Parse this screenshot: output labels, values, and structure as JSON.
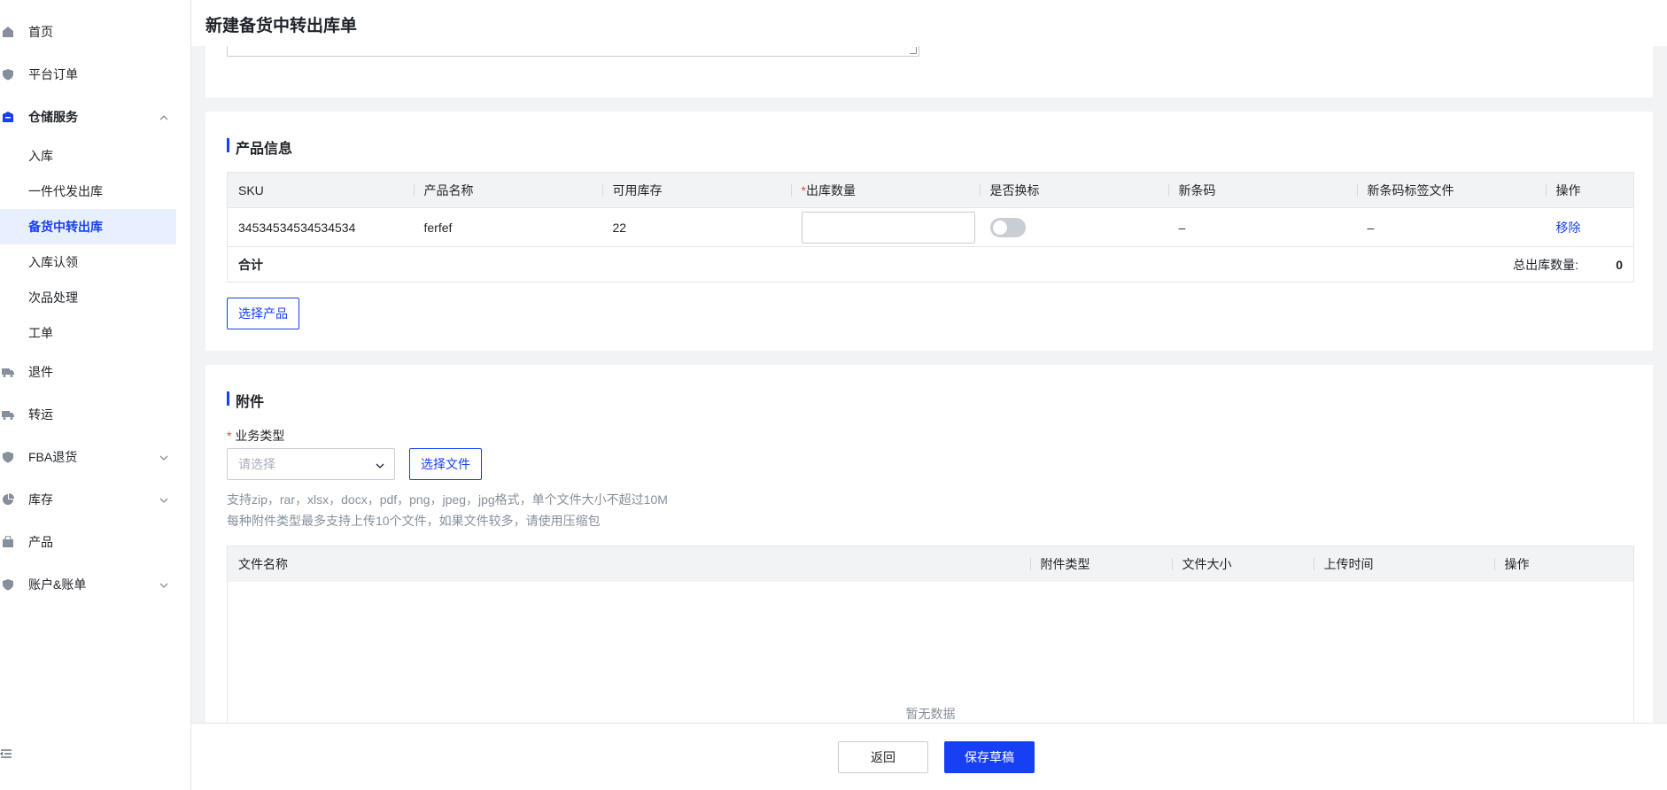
{
  "sidebar": {
    "items": [
      {
        "label": "首页",
        "icon": "home-icon"
      },
      {
        "label": "平台订单",
        "icon": "shield-icon"
      },
      {
        "label": "仓储服务",
        "icon": "warehouse-icon",
        "expanded": true
      },
      {
        "label": "退件",
        "icon": "truck-icon"
      },
      {
        "label": "转运",
        "icon": "truck-icon"
      },
      {
        "label": "FBA退货",
        "icon": "shield-icon"
      },
      {
        "label": "库存",
        "icon": "pie-chart-icon"
      },
      {
        "label": "产品",
        "icon": "bag-icon"
      },
      {
        "label": "账户&账单",
        "icon": "shield-icon"
      }
    ],
    "sub_items": [
      "入库",
      "一件代发出库",
      "备货中转出库",
      "入库认领",
      "次品处理",
      "工单"
    ],
    "active_sub": "备货中转出库"
  },
  "page": {
    "title": "新建备货中转出库单"
  },
  "products": {
    "section_title": "产品信息",
    "columns": {
      "sku": "SKU",
      "name": "产品名称",
      "stock": "可用库存",
      "qty_req": "*",
      "qty": "出库数量",
      "relabel": "是否换标",
      "barcode": "新条码",
      "barcode_file": "新条码标签文件",
      "action": "操作"
    },
    "rows": [
      {
        "sku": "34534534534534534",
        "name": "ferfef",
        "stock": "22",
        "barcode": "–",
        "barcode_file": "–",
        "action": "移除"
      }
    ],
    "total_label": "合计",
    "total_qty_label": "总出库数量:",
    "total_qty": "0",
    "select_button": "选择产品"
  },
  "attachments": {
    "section_title": "附件",
    "type_label_req": "*",
    "type_label": "业务类型",
    "type_placeholder": "请选择",
    "select_file_button": "选择文件",
    "hint1": "支持zip，rar，xlsx，docx，pdf，png，jpeg，jpg格式，单个文件大小不超过10M",
    "hint2": "每种附件类型最多支持上传10个文件，如果文件较多，请使用压缩包",
    "columns": {
      "name": "文件名称",
      "type": "附件类型",
      "size": "文件大小",
      "time": "上传时间",
      "action": "操作"
    },
    "empty_text": "暂无数据"
  },
  "footer": {
    "back_button": "返回",
    "save_button": "保存草稿"
  },
  "colors": {
    "primary": "#1740f5",
    "required": "#f53f3f"
  }
}
